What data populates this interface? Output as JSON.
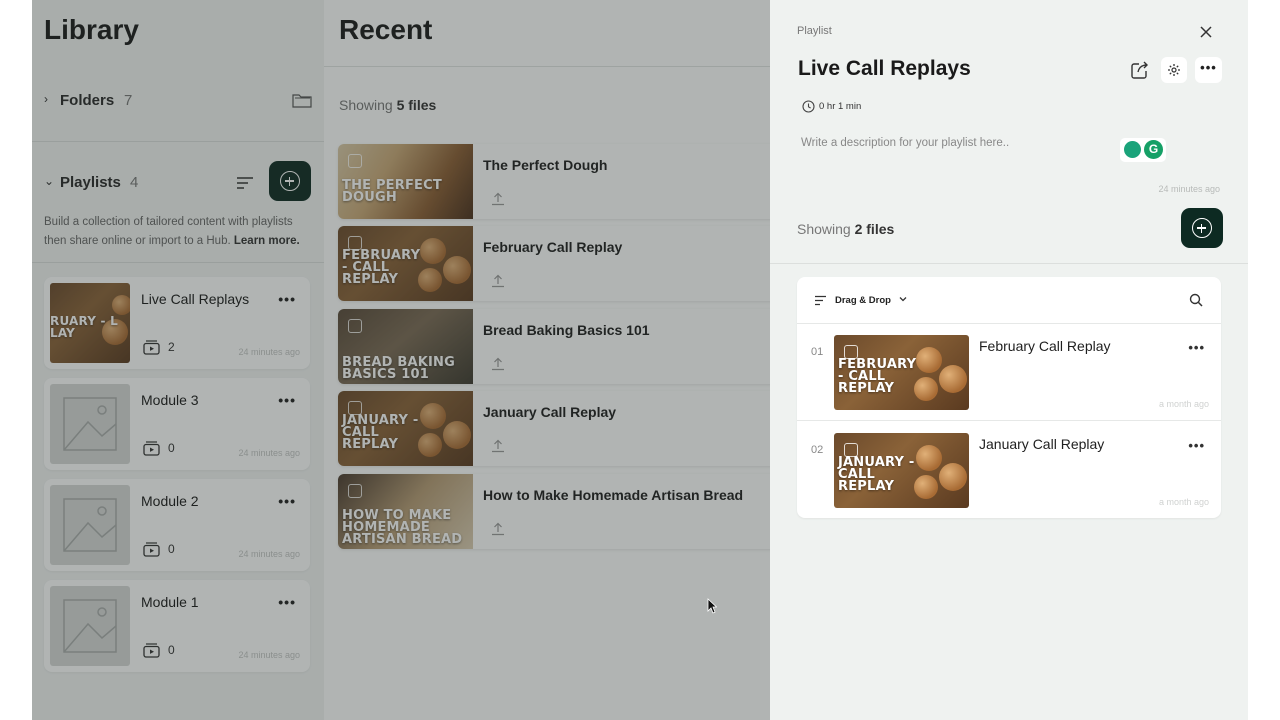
{
  "library": {
    "title": "Library",
    "folders": {
      "label": "Folders",
      "count": "7"
    },
    "playlists": {
      "label": "Playlists",
      "count": "4"
    },
    "description": "Build a collection of tailored content with playlists then share online or import to a Hub.",
    "learn_more": "Learn more.",
    "items": [
      {
        "name": "Live Call Replays",
        "count": "2",
        "time": "24 minutes ago",
        "thumb_text": "RUARY - L LAY"
      },
      {
        "name": "Module 3",
        "count": "0",
        "time": "24 minutes ago"
      },
      {
        "name": "Module 2",
        "count": "0",
        "time": "24 minutes ago"
      },
      {
        "name": "Module 1",
        "count": "0",
        "time": "24 minutes ago"
      }
    ]
  },
  "recent": {
    "title": "Recent",
    "showing_prefix": "Showing",
    "showing_count": "5 files",
    "files": [
      {
        "name": "The Perfect Dough",
        "thumb_text": "THE PERFECT DOUGH"
      },
      {
        "name": "February Call Replay",
        "thumb_text": "FEBRUARY - CALL REPLAY"
      },
      {
        "name": "Bread Baking Basics 101",
        "thumb_text": "BREAD BAKING BASICS 101"
      },
      {
        "name": "January Call Replay",
        "thumb_text": "JANUARY - CALL REPLAY"
      },
      {
        "name": "How to Make Homemade Artisan Bread",
        "thumb_text": "HOW TO MAKE HOMEMADE ARTISAN BREAD"
      }
    ]
  },
  "panel": {
    "breadcrumb": "Playlist",
    "title": "Live Call Replays",
    "duration": "0 hr 1 min",
    "description_placeholder": "Write a description for your playlist here..",
    "grammarly_letter": "G",
    "updated": "24 minutes ago",
    "showing_prefix": "Showing",
    "showing_count": "2 files",
    "sort_label": "Drag & Drop",
    "items": [
      {
        "num": "01",
        "title": "February Call Replay",
        "time": "a month ago",
        "thumb_text": "FEBRUARY - CALL REPLAY"
      },
      {
        "num": "02",
        "title": "January Call Replay",
        "time": "a month ago",
        "thumb_text": "JANUARY - CALL REPLAY"
      }
    ]
  },
  "colors": {
    "accent": "#0d2a22",
    "overlay": "rgba(40,48,44,0.36)"
  }
}
